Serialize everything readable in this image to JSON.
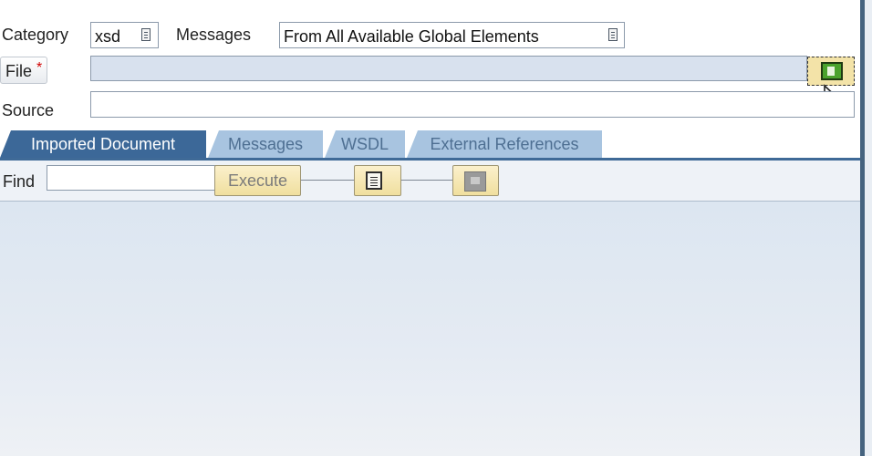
{
  "form": {
    "category_label": "Category",
    "category_value": "xsd",
    "messages_label": "Messages",
    "messages_value": "From All Available Global Elements",
    "file_label": "File",
    "required_mark": "*",
    "file_value": "",
    "source_label": "Source",
    "source_value": ""
  },
  "tabs": [
    {
      "label": "Imported Document",
      "active": true
    },
    {
      "label": "Messages",
      "active": false
    },
    {
      "label": "WSDL",
      "active": false
    },
    {
      "label": "External References",
      "active": false
    }
  ],
  "toolbar": {
    "find_label": "Find",
    "find_value": "",
    "execute_label": "Execute"
  },
  "colors": {
    "active_tab": "#3c6898",
    "inactive_tab": "#a8c4e0",
    "toolbar_button": "#f0df9e",
    "content_background": "#dce6f1"
  },
  "icons": {
    "browse": "upload-file-icon",
    "document": "document-icon",
    "copy": "copy-icon",
    "dropdown": "dropdown-list-icon"
  }
}
